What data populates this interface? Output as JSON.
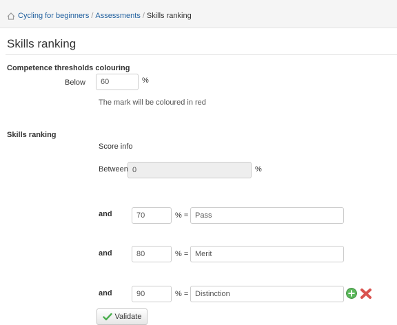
{
  "breadcrumb": {
    "items": [
      "Cycling for beginners",
      "Assessments"
    ],
    "current": "Skills ranking",
    "separator": "/"
  },
  "page": {
    "title": "Skills ranking"
  },
  "thresholds": {
    "heading": "Competence thresholds colouring",
    "below_label": "Below",
    "below_value": "60",
    "unit": "%",
    "help": "The mark will be coloured in red"
  },
  "ranking": {
    "heading": "Skills ranking",
    "score_info": "Score info",
    "between_label": "Between",
    "between_value": "0",
    "unit": "%",
    "and_label": "and",
    "equals": "% =",
    "rows": [
      {
        "value": "70",
        "name": "Pass"
      },
      {
        "value": "80",
        "name": "Merit"
      },
      {
        "value": "90",
        "name": "Distinction"
      }
    ]
  },
  "actions": {
    "validate_label": "Validate"
  },
  "icons": {
    "home": "home-icon",
    "add": "add-icon",
    "delete": "delete-icon",
    "check": "check-icon"
  },
  "colors": {
    "link": "#1f5f9e",
    "add": "#5cb85c",
    "delete": "#d9534f",
    "check": "#4caf50"
  }
}
